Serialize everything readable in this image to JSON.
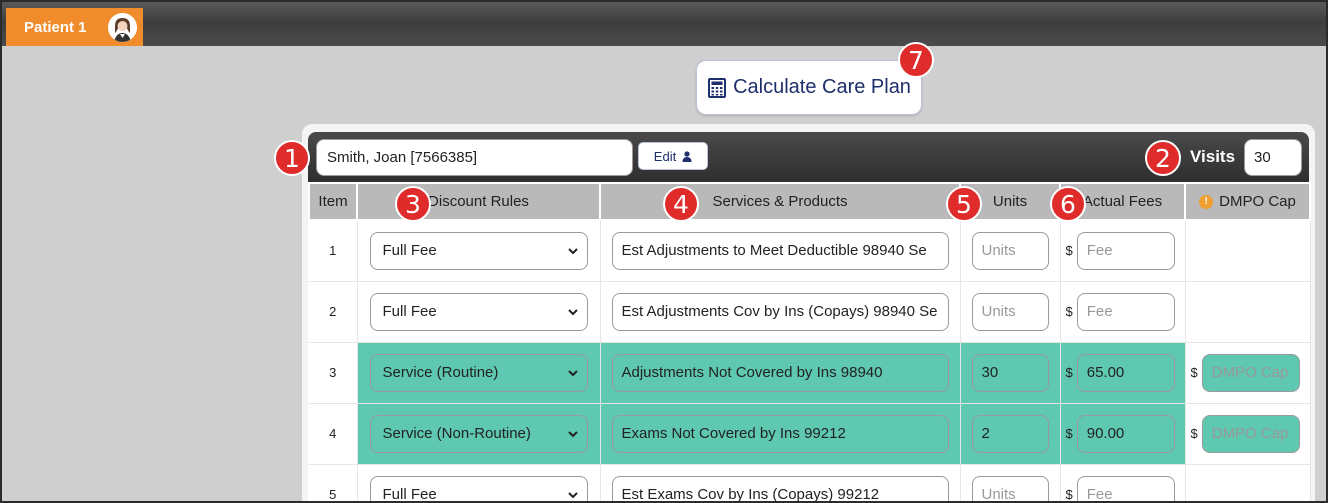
{
  "tab": {
    "label": "Patient 1"
  },
  "calculate_button": {
    "label": "Calculate Care Plan"
  },
  "patient_field": {
    "value": "Smith, Joan [7566385]"
  },
  "edit_button": {
    "label": "Edit"
  },
  "visits": {
    "label": "Visits",
    "value": "30"
  },
  "badges": [
    "1",
    "2",
    "3",
    "4",
    "5",
    "6",
    "7"
  ],
  "columns": [
    "Item",
    "Discount Rules",
    "Services & Products",
    "Units",
    "Actual Fees",
    "DMPO Cap"
  ],
  "placeholders": {
    "units": "Units",
    "fee": "Fee",
    "cap": "DMPO Cap"
  },
  "currency": "$",
  "rows": [
    {
      "item": "1",
      "rule": "Full Fee",
      "service": "Est Adjustments to Meet Deductible 98940 Se",
      "units": "",
      "fee": "",
      "cap": null,
      "highlight": false
    },
    {
      "item": "2",
      "rule": "Full Fee",
      "service": "Est Adjustments Cov by Ins (Copays) 98940 Se",
      "units": "",
      "fee": "",
      "cap": null,
      "highlight": false
    },
    {
      "item": "3",
      "rule": "Service (Routine)",
      "service": "Adjustments Not Covered by Ins 98940",
      "units": "30",
      "fee": "65.00",
      "cap": "",
      "highlight": true
    },
    {
      "item": "4",
      "rule": "Service (Non-Routine)",
      "service": "Exams Not Covered by Ins 99212",
      "units": "2",
      "fee": "90.00",
      "cap": "",
      "highlight": true
    },
    {
      "item": "5",
      "rule": "Full Fee",
      "service": "Est Exams Cov by Ins (Copays) 99212",
      "units": "",
      "fee": "",
      "cap": null,
      "highlight": false
    }
  ],
  "colors": {
    "accent_orange": "#f08c2c",
    "badge_red": "#e02b2b",
    "highlight_teal": "#5ec8b1",
    "button_text": "#1f2f6b"
  }
}
